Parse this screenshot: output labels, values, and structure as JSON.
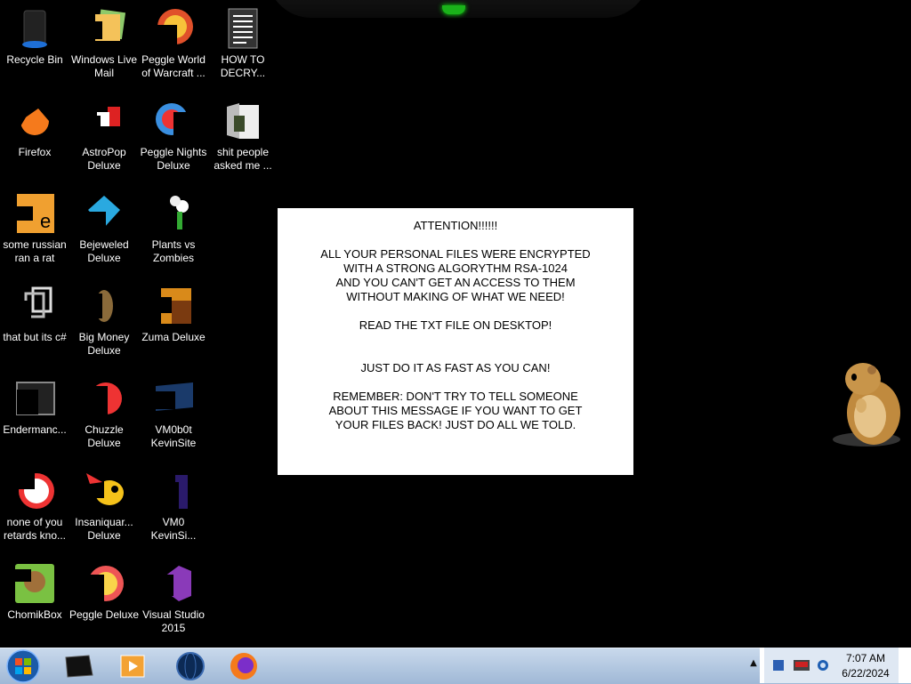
{
  "desktop_icons": [
    {
      "label": "Recycle Bin",
      "icon": "recycle-bin-icon"
    },
    {
      "label": "Windows Live\nMail",
      "icon": "mail-icon"
    },
    {
      "label": "Peggle World\nof Warcraft ...",
      "icon": "peggle-wow-icon"
    },
    {
      "label": "HOW TO\nDECRY...",
      "icon": "text-file-icon"
    },
    {
      "label": "Firefox",
      "icon": "firefox-icon"
    },
    {
      "label": "AstroPop\nDeluxe",
      "icon": "astropop-icon"
    },
    {
      "label": "Peggle Nights\nDeluxe",
      "icon": "peggle-nights-icon"
    },
    {
      "label": "shit people\nasked me ...",
      "icon": "folder-icon"
    },
    {
      "label": "some russian\nran a rat",
      "icon": "exe-icon"
    },
    {
      "label": "Bejeweled\nDeluxe",
      "icon": "bejeweled-icon"
    },
    {
      "label": "Plants vs\nZombies",
      "icon": "plants-vs-zombies-icon"
    },
    {
      "label": "that but its c#",
      "icon": "shortcut-icon"
    },
    {
      "label": "Big Money\nDeluxe",
      "icon": "big-money-icon"
    },
    {
      "label": "Zuma Deluxe",
      "icon": "zuma-icon"
    },
    {
      "label": "Endermanc...",
      "icon": "endermanch-icon"
    },
    {
      "label": "Chuzzle\nDeluxe",
      "icon": "chuzzle-icon"
    },
    {
      "label": "VM0b0t\nKevinSite",
      "icon": "vm-bot-icon"
    },
    {
      "label": "none of you\nretards kno...",
      "icon": "peggle-icon"
    },
    {
      "label": "Insaniquar...\nDeluxe",
      "icon": "insaniquarium-icon"
    },
    {
      "label": "VM0\nKevinSi...",
      "icon": "vm-icon"
    },
    {
      "label": "ChomikBox",
      "icon": "chomikbox-icon"
    },
    {
      "label": "Peggle Deluxe",
      "icon": "peggle-deluxe-icon"
    },
    {
      "label": "Visual Studio\n2015",
      "icon": "visual-studio-icon"
    }
  ],
  "message_box": {
    "text": "ATTENTION!!!!!!\n\nALL YOUR PERSONAL FILES WERE ENCRYPTED\n     WITH A STRONG ALGORYTHM RSA-1024\nAND YOU CAN'T GET AN ACCESS TO THEM\n     WITHOUT MAKING OF WHAT WE NEED!\n\nREAD THE TXT FILE ON DESKTOP!\n\n\nJUST DO IT AS FAST AS YOU CAN!\n\nREMEMBER: DON'T TRY TO TELL SOMEONE\nABOUT THIS MESSAGE IF YOU WANT TO GET\nYOUR FILES BACK! JUST DO ALL WE TOLD."
  },
  "taskbar": {
    "start_icon": "windows-start-icon",
    "pinned": [
      "monitor-icon",
      "media-player-icon",
      "globe-icon",
      "firefox-icon"
    ],
    "clock_time": "7:07 AM",
    "clock_date": "6/22/2024",
    "tray_arrow": "▲"
  },
  "colors": {
    "taskbar": "#b3c8e2",
    "desktop": "#000000",
    "message_bg": "#ffffff"
  }
}
